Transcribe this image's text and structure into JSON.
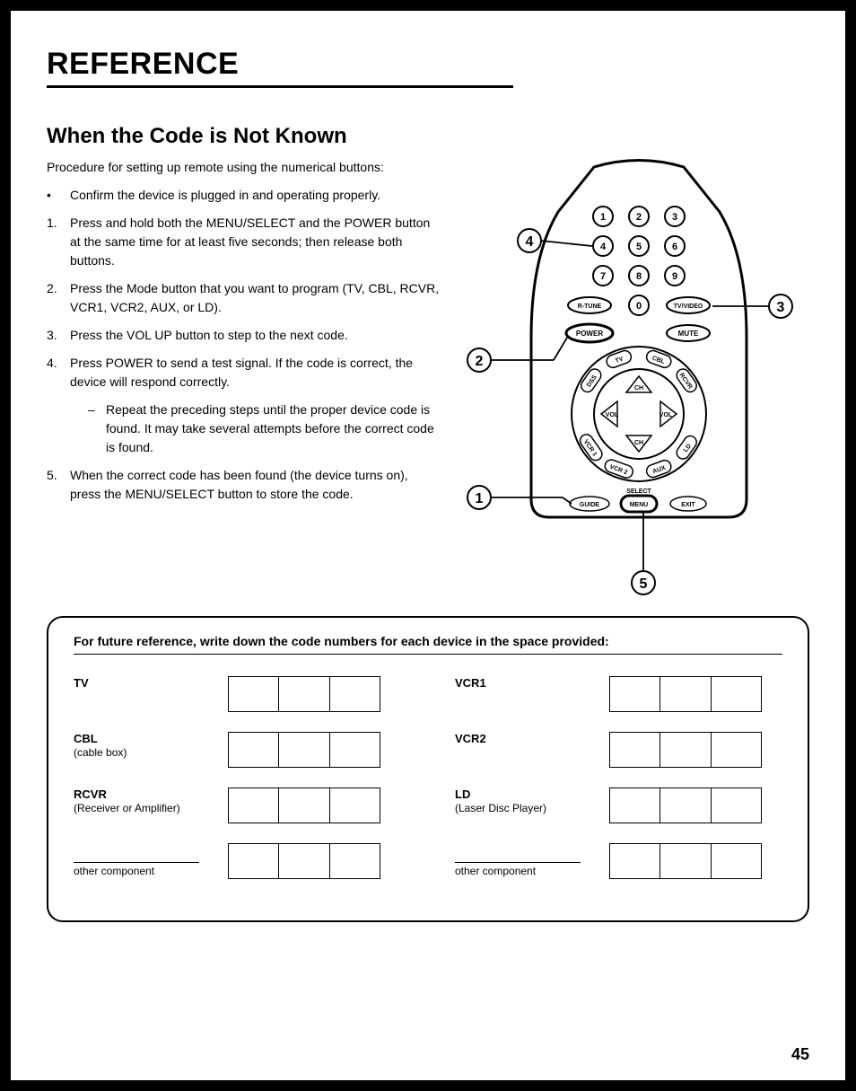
{
  "header": {
    "title": "REFERENCE"
  },
  "section": {
    "title": "When the Code is Not Known",
    "intro": "Procedure for setting up remote using the numerical buttons:",
    "items": [
      {
        "marker": "•",
        "text": "Confirm the device is plugged in and operating properly."
      },
      {
        "marker": "1.",
        "text": "Press and hold both the MENU/SELECT and the POWER button at the same time for at least five seconds; then release both buttons."
      },
      {
        "marker": "2.",
        "text": "Press the Mode button that you want to program (TV, CBL, RCVR, VCR1, VCR2, AUX, or LD)."
      },
      {
        "marker": "3.",
        "text": "Press the VOL UP button to step to the next code."
      },
      {
        "marker": "4.",
        "text": "Press POWER to send a test signal. If the code is correct, the device will respond correctly.",
        "sub": {
          "marker": "–",
          "text": "Repeat the preceding steps until the proper device code is found. It may take several attempts before the correct code is found."
        }
      },
      {
        "marker": "5.",
        "text": "When the correct code has been found (the device turns on), press the MENU/SELECT button to store the code."
      }
    ]
  },
  "remote": {
    "callouts": [
      "1",
      "2",
      "3",
      "4",
      "5"
    ],
    "buttons": {
      "num": [
        "1",
        "2",
        "3",
        "4",
        "5",
        "6",
        "7",
        "8",
        "9",
        "0"
      ],
      "rtune": "R-TUNE",
      "tvvideo": "TV/VIDEO",
      "power": "POWER",
      "mute": "MUTE",
      "modes": [
        "DSS",
        "TV",
        "CBL",
        "RCVR",
        "LD",
        "AUX",
        "VCR 2",
        "VCR 1"
      ],
      "ch": "CH",
      "vol": "VOL",
      "select": "SELECT",
      "guide": "GUIDE",
      "menu": "MENU",
      "exit": "EXIT"
    }
  },
  "codebox": {
    "header": "For future reference, write down the code numbers for each device in the space provided:",
    "left": [
      {
        "label": "TV",
        "sub": ""
      },
      {
        "label": "CBL",
        "sub": "(cable box)"
      },
      {
        "label": "RCVR",
        "sub": "(Receiver or Amplifier)"
      },
      {
        "label": "",
        "sub": "other component",
        "other": true
      }
    ],
    "right": [
      {
        "label": "VCR1",
        "sub": ""
      },
      {
        "label": "VCR2",
        "sub": ""
      },
      {
        "label": "LD",
        "sub": "(Laser Disc Player)"
      },
      {
        "label": "",
        "sub": "other component",
        "other": true
      }
    ]
  },
  "page_number": "45"
}
